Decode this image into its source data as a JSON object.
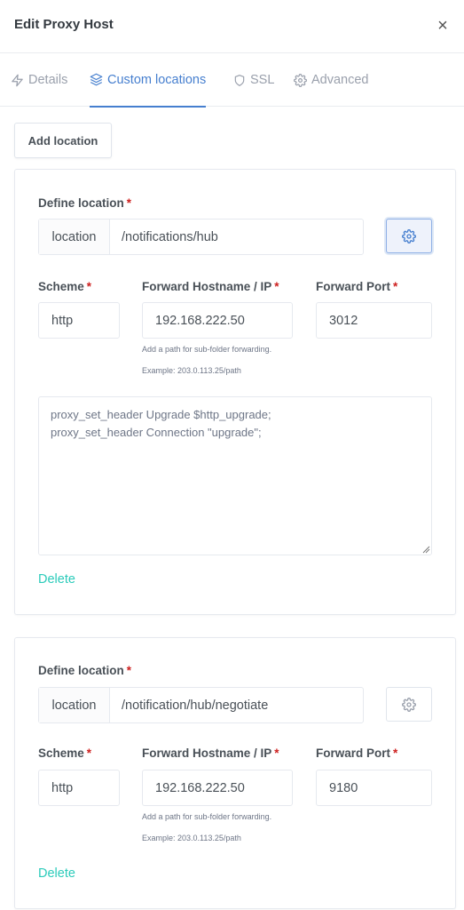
{
  "modal": {
    "title": "Edit Proxy Host",
    "close_icon": "close-icon"
  },
  "tabs": [
    {
      "label": "Details",
      "icon": "bolt-icon",
      "active": false
    },
    {
      "label": "Custom locations",
      "icon": "layers-icon",
      "active": true
    },
    {
      "label": "SSL",
      "icon": "shield-icon",
      "active": false
    },
    {
      "label": "Advanced",
      "icon": "gear-icon",
      "active": false
    }
  ],
  "colors": {
    "accent": "#467fcf",
    "required": "#cd201f",
    "delete_link": "#2bcbba",
    "muted_tab": "#9aa0ac"
  },
  "add_location_label": "Add location",
  "locations": [
    {
      "define_label": "Define location",
      "required_mark": "*",
      "prefix": "location",
      "path": "/notifications/hub",
      "advanced_toggle_active": true,
      "scheme_label": "Scheme",
      "scheme": "http",
      "host_label": "Forward Hostname / IP",
      "host": "192.168.222.50",
      "port_label": "Forward Port",
      "port": "3012",
      "hint_1": "Add a path for sub-folder forwarding.",
      "hint_2": "Example: 203.0.113.25/path",
      "advanced_config": "proxy_set_header Upgrade $http_upgrade;\nproxy_set_header Connection \"upgrade\";",
      "delete_label": "Delete"
    },
    {
      "define_label": "Define location",
      "required_mark": "*",
      "prefix": "location",
      "path": "/notification/hub/negotiate",
      "advanced_toggle_active": false,
      "scheme_label": "Scheme",
      "scheme": "http",
      "host_label": "Forward Hostname / IP",
      "host": "192.168.222.50",
      "port_label": "Forward Port",
      "port": "9180",
      "hint_1": "Add a path for sub-folder forwarding.",
      "hint_2": "Example: 203.0.113.25/path",
      "delete_label": "Delete"
    }
  ]
}
